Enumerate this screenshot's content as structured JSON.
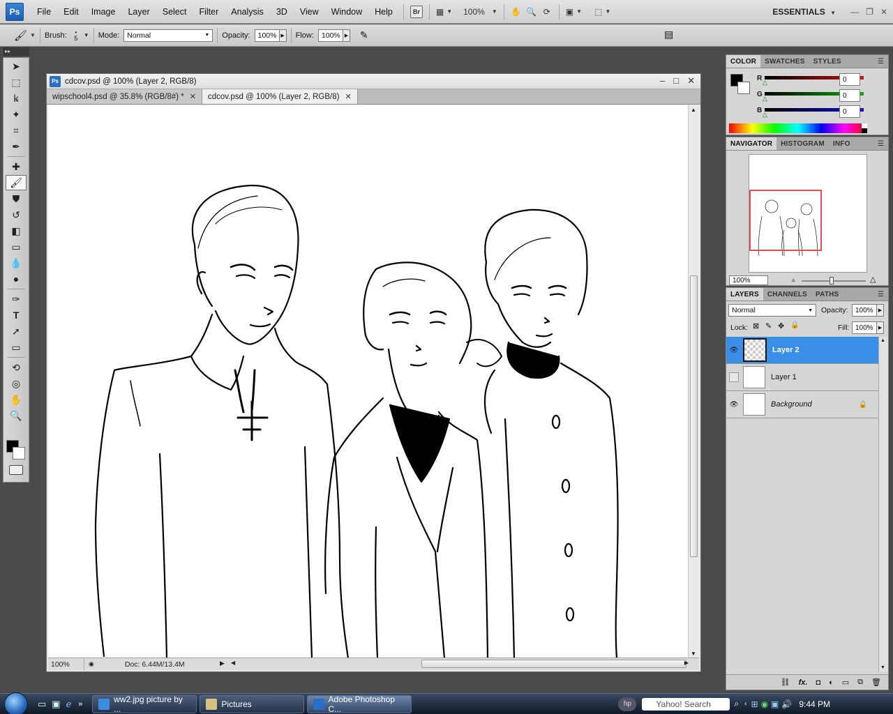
{
  "app": {
    "logo": "Ps",
    "workspace": "ESSENTIALS",
    "zoom": "100%",
    "bridge_label": "Br"
  },
  "menu": [
    "File",
    "Edit",
    "Image",
    "Layer",
    "Select",
    "Filter",
    "Analysis",
    "3D",
    "View",
    "Window",
    "Help"
  ],
  "options": {
    "brush_label": "Brush:",
    "brush_size": "5",
    "mode_label": "Mode:",
    "mode_value": "Normal",
    "opacity_label": "Opacity:",
    "opacity_value": "100%",
    "flow_label": "Flow:",
    "flow_value": "100%"
  },
  "document": {
    "title": "cdcov.psd @ 100% (Layer 2, RGB/8)",
    "tabs": [
      {
        "label": "wipschool4.psd @ 35.8% (RGB/8#) *"
      },
      {
        "label": "cdcov.psd @ 100% (Layer 2, RGB/8)"
      }
    ],
    "status_zoom": "100%",
    "status_doc": "Doc: 6.44M/13.4M"
  },
  "color_panel": {
    "tabs": [
      "COLOR",
      "SWATCHES",
      "STYLES"
    ],
    "r_label": "R",
    "g_label": "G",
    "b_label": "B",
    "r_value": "0",
    "g_value": "0",
    "b_value": "0"
  },
  "navigator_panel": {
    "tabs": [
      "NAVIGATOR",
      "HISTOGRAM",
      "INFO"
    ],
    "zoom": "100%"
  },
  "layers_panel": {
    "tabs": [
      "LAYERS",
      "CHANNELS",
      "PATHS"
    ],
    "blend_mode": "Normal",
    "opacity_label": "Opacity:",
    "opacity_value": "100%",
    "lock_label": "Lock:",
    "fill_label": "Fill:",
    "fill_value": "100%",
    "layers": [
      {
        "name": "Layer 2",
        "visible": true,
        "selected": true
      },
      {
        "name": "Layer 1",
        "visible": false,
        "selected": false
      },
      {
        "name": "Background",
        "visible": true,
        "selected": false,
        "locked": true
      }
    ],
    "footer_fx": "fx."
  },
  "taskbar": {
    "tasks": [
      {
        "label": "ww2.jpg picture by ..."
      },
      {
        "label": "Pictures"
      },
      {
        "label": "Adobe Photoshop C..."
      }
    ],
    "search_placeholder": "Yahoo! Search",
    "clock": "9:44 PM"
  },
  "colors": {
    "selection_blue": "#3a8ee6",
    "nav_frame": "#e05050",
    "r_slider": "#cc1010",
    "g_slider": "#10aa10",
    "b_slider": "#1010cc"
  }
}
